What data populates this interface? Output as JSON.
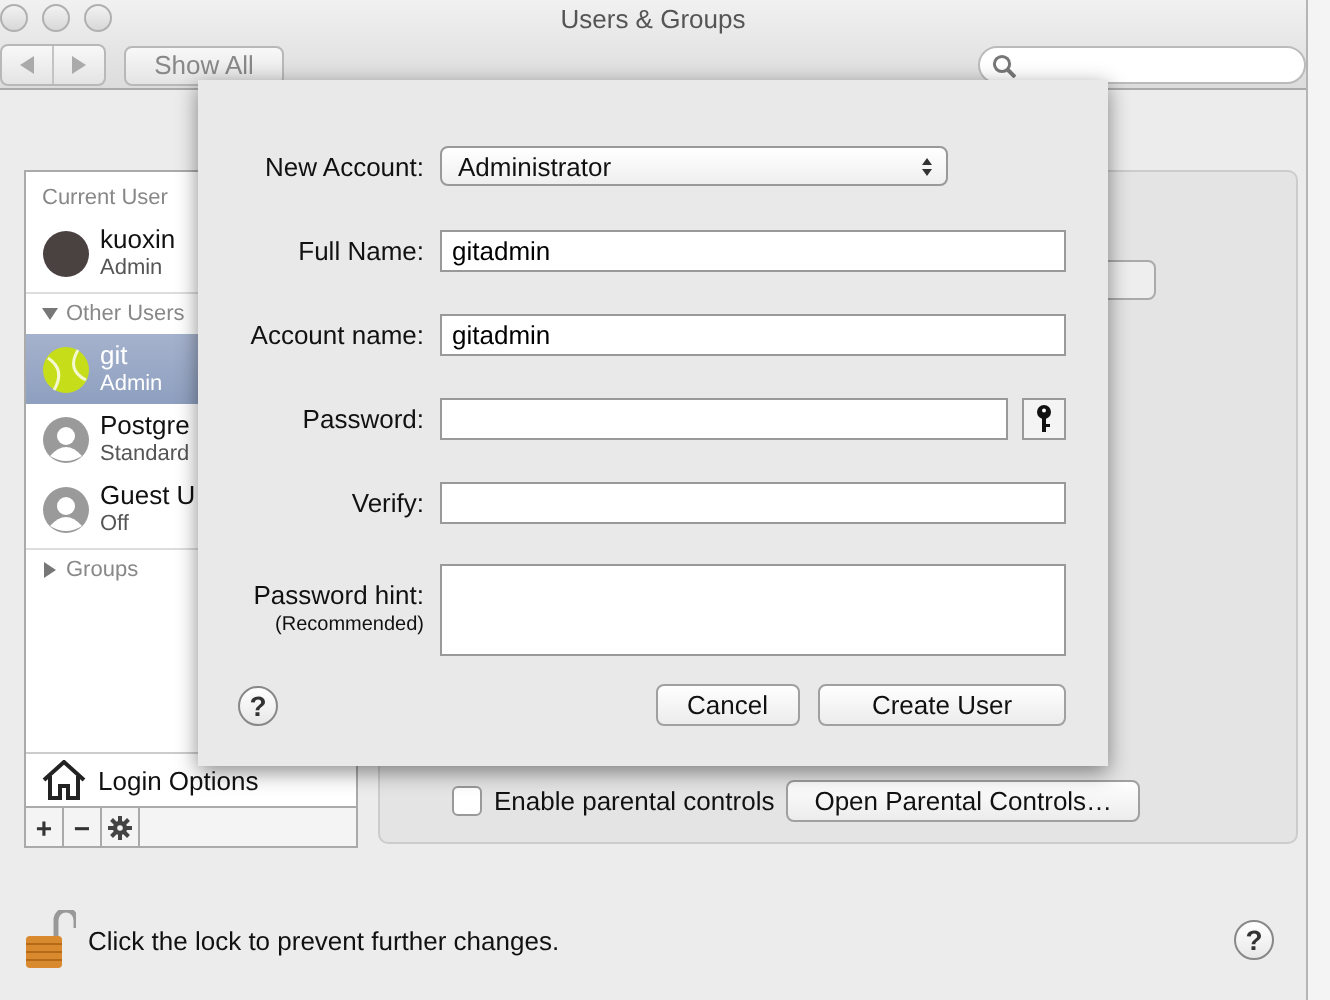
{
  "window": {
    "title": "Users & Groups"
  },
  "toolbar": {
    "show_all": "Show All"
  },
  "sidebar": {
    "sections": [
      {
        "header": "Current User",
        "users": [
          {
            "name": "kuoxin",
            "role": "Admin",
            "kind": "photo",
            "selected": false
          }
        ]
      },
      {
        "header": "Other Users",
        "expanded": true,
        "users": [
          {
            "name": "git",
            "role": "Admin",
            "kind": "ball",
            "selected": true
          },
          {
            "name": "Postgre",
            "role": "Standard",
            "kind": "silhouette",
            "selected": false
          },
          {
            "name": "Guest U",
            "role": "Off",
            "kind": "silhouette",
            "selected": false
          }
        ]
      },
      {
        "header": "Groups",
        "expanded": false
      }
    ],
    "login_options": "Login Options",
    "footer_buttons": [
      {
        "kind": "plus",
        "label": "+"
      },
      {
        "kind": "minus",
        "label": "−"
      },
      {
        "kind": "gear"
      }
    ]
  },
  "panel": {
    "parental": {
      "label": "Enable parental controls",
      "checked": false
    },
    "open_parental": "Open Parental Controls…"
  },
  "sheet": {
    "fields": [
      {
        "kind": "popup",
        "label": "New Account:",
        "value": "Administrator"
      },
      {
        "kind": "text",
        "label": "Full Name:",
        "value": "gitadmin"
      },
      {
        "kind": "text",
        "label": "Account name:",
        "value": "gitadmin"
      },
      {
        "kind": "password",
        "label": "Password:"
      },
      {
        "kind": "text",
        "label": "Verify:"
      },
      {
        "kind": "textarea",
        "label": "Password hint:",
        "sublabel": "(Recommended)"
      }
    ],
    "help": "?",
    "buttons": [
      "Cancel",
      "Create User"
    ]
  },
  "help": "?",
  "lock_text": "Click the lock to prevent further changes."
}
